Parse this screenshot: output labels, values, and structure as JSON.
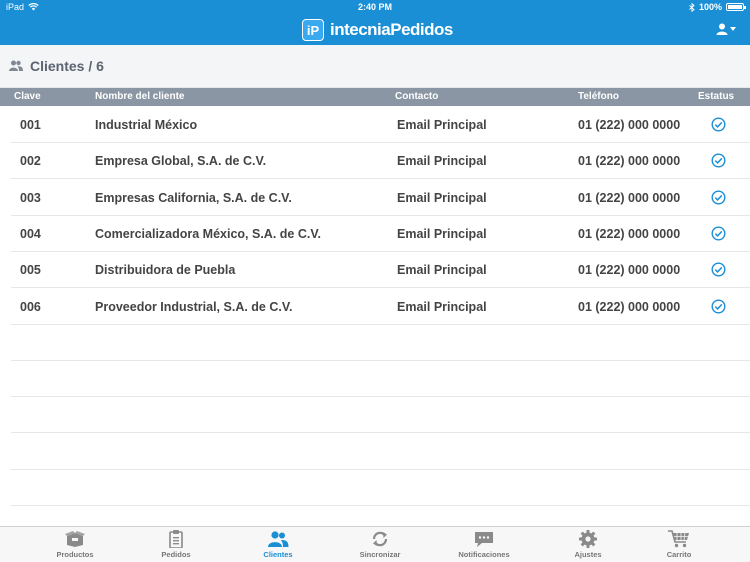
{
  "status_bar": {
    "device": "iPad",
    "time": "2:40 PM",
    "battery": "100%",
    "battery_level": 1.0
  },
  "app": {
    "logo_text": "iP",
    "title": "intecniaPedidos"
  },
  "subheader": {
    "title": "Clientes / 6"
  },
  "table": {
    "columns": {
      "clave": "Clave",
      "nombre": "Nombre del cliente",
      "contacto": "Contacto",
      "telefono": "Teléfono",
      "estatus": "Estatus"
    },
    "rows": [
      {
        "clave": "001",
        "nombre": "Industrial México",
        "contacto": "Email Principal",
        "telefono": "01 (222) 000 0000",
        "estatus": "check-circle-icon"
      },
      {
        "clave": "002",
        "nombre": "Empresa Global, S.A. de C.V.",
        "contacto": "Email Principal",
        "telefono": "01 (222) 000 0000",
        "estatus": "check-circle-icon"
      },
      {
        "clave": "003",
        "nombre": "Empresas California, S.A. de C.V.",
        "contacto": "Email Principal",
        "telefono": "01 (222) 000 0000",
        "estatus": "check-circle-icon"
      },
      {
        "clave": "004",
        "nombre": "Comercializadora México, S.A. de C.V.",
        "contacto": "Email Principal",
        "telefono": "01 (222) 000 0000",
        "estatus": "check-circle-icon"
      },
      {
        "clave": "005",
        "nombre": "Distribuidora de Puebla",
        "contacto": "Email Principal",
        "telefono": "01 (222) 000 0000",
        "estatus": "check-circle-icon"
      },
      {
        "clave": "006",
        "nombre": "Proveedor Industrial, S.A. de C.V.",
        "contacto": "Email Principal",
        "telefono": "01 (222) 000 0000",
        "estatus": "check-circle-icon"
      }
    ]
  },
  "tabs": [
    {
      "label": "Productos",
      "icon": "box-icon",
      "active": false
    },
    {
      "label": "Pedidos",
      "icon": "clipboard-icon",
      "active": false
    },
    {
      "label": "Clientes",
      "icon": "users-icon",
      "active": true
    },
    {
      "label": "Sincronizar",
      "icon": "sync-icon",
      "active": false
    },
    {
      "label": "Notificaciones",
      "icon": "chat-icon",
      "active": false
    },
    {
      "label": "Ajustes",
      "icon": "gear-icon",
      "active": false
    },
    {
      "label": "Carrito",
      "icon": "cart-icon",
      "active": false
    }
  ],
  "colors": {
    "brand": "#1b8fd6",
    "header_row": "#8a96a3",
    "status_check": "#1b8fd6",
    "tab_inactive": "#777777"
  }
}
